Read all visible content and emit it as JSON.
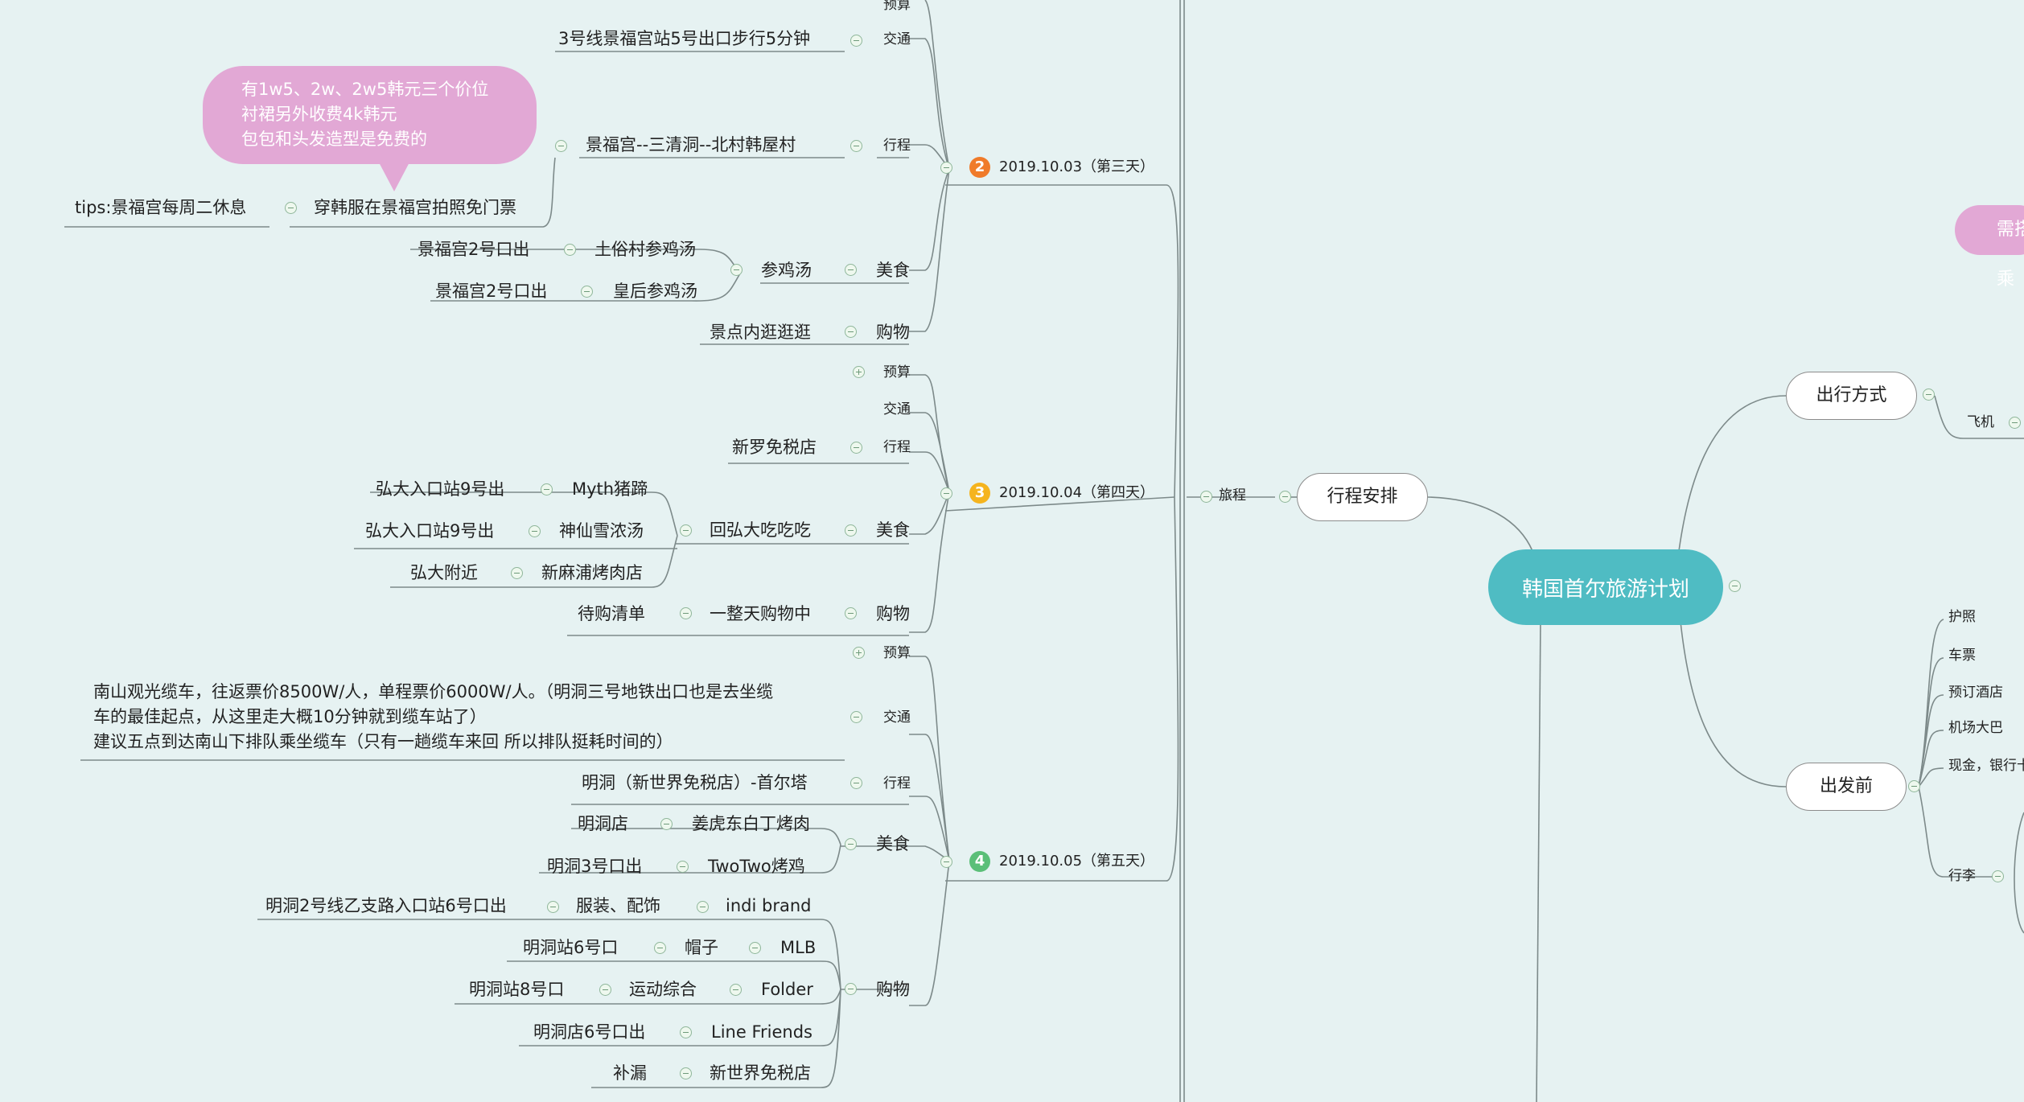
{
  "root": "韩国首尔旅游计划",
  "main_branches": {
    "itinerary": "行程安排",
    "travel": "旅程",
    "transport_mode": "出行方式",
    "before": "出发前"
  },
  "days": [
    {
      "num": "2",
      "date": "2019.10.03（第三天）",
      "color": "#f07b2a"
    },
    {
      "num": "3",
      "date": "2019.10.04（第四天）",
      "color": "#f5b41e"
    },
    {
      "num": "4",
      "date": "2019.10.05（第五天）",
      "color": "#5bbf78"
    }
  ],
  "categories": {
    "budget": "预算",
    "transport": "交通",
    "route": "行程",
    "food": "美食",
    "shopping": "购物"
  },
  "day2": {
    "transport": "3号线景福宫站5号出口步行5分钟",
    "route": "景福宫--三清洞--北村韩屋村",
    "route_note": "穿韩服在景福宫拍照免门票",
    "route_tip": "tips:景福宫每周二休息",
    "bubble": [
      "有1w5、2w、2w5韩元三个价位",
      "衬裙另外收费4k韩元",
      "包包和头发造型是免费的"
    ],
    "food": "参鸡汤",
    "food_items": [
      {
        "name": "土俗村参鸡汤",
        "loc": "景福宫2号口出"
      },
      {
        "name": "皇后参鸡汤",
        "loc": "景福宫2号口出"
      }
    ],
    "shopping": "景点内逛逛逛"
  },
  "day3": {
    "route": "新罗免税店",
    "food": "回弘大吃吃吃",
    "food_items": [
      {
        "name": "Myth猪蹄",
        "loc": "弘大入口站9号出"
      },
      {
        "name": "神仙雪浓汤",
        "loc": "弘大入口站9号出"
      },
      {
        "name": "新麻浦烤肉店",
        "loc": "弘大附近"
      }
    ],
    "shopping": "一整天购物中",
    "shopping_note": "待购清单"
  },
  "day4": {
    "transport": [
      "南山观光缆车，往返票价8500W/人，单程票价6000W/人。（明洞三号地铁出口也是去坐缆",
      "车的最佳起点，从这里走大概10分钟就到缆车站了）",
      "建议五点到达南山下排队乘坐缆车（只有一趟缆车来回 所以排队挺耗时间的）"
    ],
    "route": "明洞（新世界免税店）-首尔塔",
    "food_items": [
      {
        "name": "姜虎东白丁烤肉",
        "loc": "明洞店"
      },
      {
        "name": "TwoTwo烤鸡",
        "loc": "明洞3号口出"
      }
    ],
    "shopping_items": [
      {
        "name": "indi brand",
        "sub": "服装、配饰",
        "loc": "明洞2号线乙支路入口站6号口出"
      },
      {
        "name": "MLB",
        "sub": "帽子",
        "loc": "明洞站6号口"
      },
      {
        "name": "Folder",
        "sub": "运动综合",
        "loc": "明洞站8号口"
      },
      {
        "name": "Line Friends",
        "sub": "",
        "loc": "明洞店6号口出"
      },
      {
        "name": "新世界免税店",
        "sub": "",
        "loc": "补漏"
      }
    ]
  },
  "right": {
    "plane": "飞机",
    "pink_pill": "需搭乘",
    "before_items": [
      "护照",
      "车票",
      "预订酒店",
      "机场大巴",
      "现金，银行卡"
    ],
    "luggage": "行李"
  },
  "colors": {
    "background": "#e6f2f2",
    "root": "#4fbcc3",
    "bubble": "#e2a8d5",
    "line": "#7d8a8a"
  }
}
